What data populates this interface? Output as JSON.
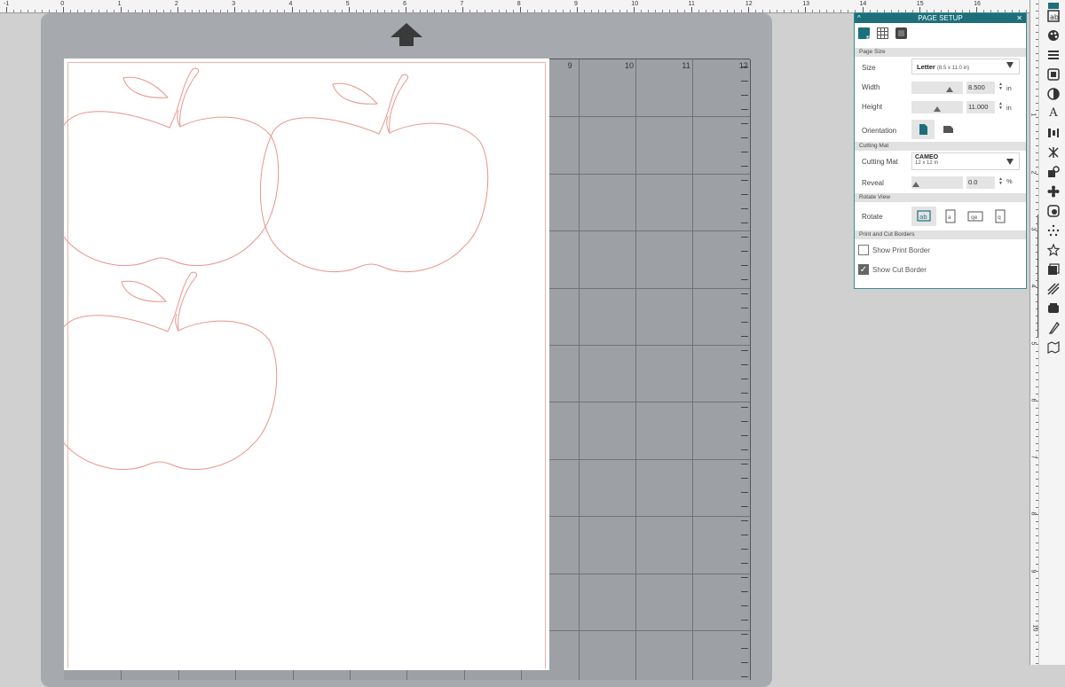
{
  "ruler": {
    "top_numbers": [
      "-1",
      "0",
      "1",
      "2",
      "3",
      "4",
      "5",
      "6",
      "7",
      "8",
      "9",
      "10",
      "11",
      "12",
      "13",
      "14",
      "15",
      "16"
    ],
    "right_numbers": [
      "1",
      "2",
      "3",
      "4",
      "5",
      "6",
      "7",
      "8",
      "9",
      "10"
    ]
  },
  "mat": {
    "grid_numbers": [
      "9",
      "10",
      "11",
      "12"
    ]
  },
  "page_setup": {
    "title": "PAGE SETUP",
    "sections": {
      "page_size": "Page Size",
      "cutting_mat": "Cutting Mat",
      "rotate_view": "Rotate View",
      "print_cut_borders": "Print and Cut Borders"
    },
    "size": {
      "label": "Size",
      "value": "Letter",
      "detail": "(8.5 x 11.0 in)"
    },
    "width": {
      "label": "Width",
      "value": "8.500",
      "unit": "in",
      "slider_fraction": 0.8
    },
    "height": {
      "label": "Height",
      "value": "11.000",
      "unit": "in",
      "slider_fraction": 0.5
    },
    "orientation": {
      "label": "Orientation"
    },
    "cutting_mat": {
      "label": "Cutting Mat",
      "value": "CAMEO",
      "detail": "12 x 12 in"
    },
    "reveal": {
      "label": "Reveal",
      "value": "0.0",
      "unit": "%",
      "slider_fraction": 0.0
    },
    "rotate": {
      "label": "Rotate"
    },
    "show_print_border": {
      "label": "Show Print Border",
      "checked": false
    },
    "show_cut_border": {
      "label": "Show Cut Border",
      "checked": true
    }
  },
  "colors": {
    "panel_header": "#1c6f7b",
    "accent": "#1c6f7b",
    "cut_line": "#e8958a"
  }
}
